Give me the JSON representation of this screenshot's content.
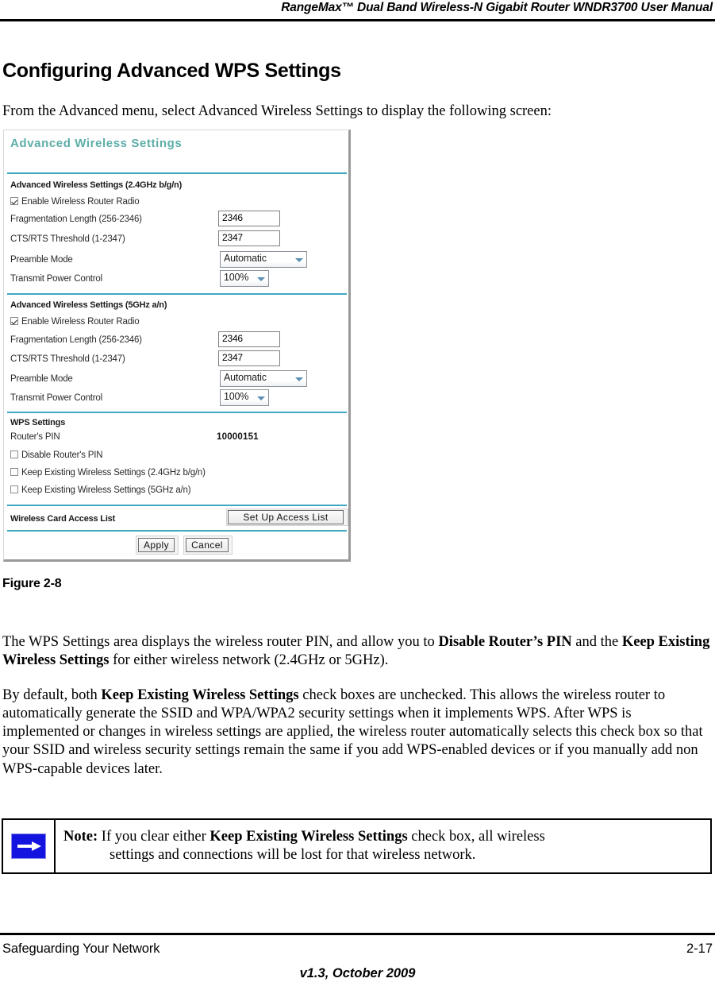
{
  "header": {
    "title": "RangeMax™ Dual Band Wireless-N Gigabit Router WNDR3700 User Manual"
  },
  "page": {
    "heading": "Configuring Advanced WPS Settings",
    "intro": "From the Advanced menu, select Advanced Wireless Settings to display the following screen:",
    "figure_caption": "Figure 2-8"
  },
  "figure": {
    "window_title": "Advanced Wireless Settings",
    "title_color": "#5cada7",
    "divider_color": "#3fa9c4",
    "sections": [
      {
        "title": "Advanced Wireless Settings (2.4GHz b/g/n)",
        "enable_radio_label": "Enable Wireless Router Radio",
        "enable_radio_checked": true,
        "fields": [
          {
            "label": "Fragmentation Length (256-2346)",
            "value": "2346",
            "type": "text"
          },
          {
            "label": "CTS/RTS Threshold (1-2347)",
            "value": "2347",
            "type": "text"
          },
          {
            "label": "Preamble Mode",
            "value": "Automatic",
            "type": "select"
          },
          {
            "label": "Transmit Power Control",
            "value": "100%",
            "type": "select"
          }
        ]
      },
      {
        "title": "Advanced Wireless Settings (5GHz a/n)",
        "enable_radio_label": "Enable Wireless Router Radio",
        "enable_radio_checked": true,
        "fields": [
          {
            "label": "Fragmentation Length (256-2346)",
            "value": "2346",
            "type": "text"
          },
          {
            "label": "CTS/RTS Threshold (1-2347)",
            "value": "2347",
            "type": "text"
          },
          {
            "label": "Preamble Mode",
            "value": "Automatic",
            "type": "select"
          },
          {
            "label": "Transmit Power Control",
            "value": "100%",
            "type": "select"
          }
        ]
      }
    ],
    "wps": {
      "title": "WPS Settings",
      "pin_label": "Router's PIN",
      "pin_value": "10000151",
      "checkboxes": [
        {
          "label": "Disable Router's PIN",
          "checked": false
        },
        {
          "label": "Keep Existing Wireless Settings (2.4GHz b/g/n)",
          "checked": false
        },
        {
          "label": "Keep Existing Wireless Settings (5GHz a/n)",
          "checked": false
        }
      ]
    },
    "access_list": {
      "label": "Wireless Card Access List",
      "button": "Set Up Access List"
    },
    "actions": {
      "apply": "Apply",
      "cancel": "Cancel"
    }
  },
  "body": {
    "para1_a": "The WPS Settings area displays the wireless router PIN, and allow you to ",
    "para1_b": "Disable Router’s PIN",
    "para1_c": " and the ",
    "para1_d": "Keep Existing Wireless Settings",
    "para1_e": " for either wireless network (2.4GHz or 5GHz).",
    "para2_a": "By default, both ",
    "para2_b": "Keep Existing Wireless Settings",
    "para2_c": " check boxes are unchecked. This allows the wireless router to automatically generate the SSID and WPA/WPA2 security settings when it implements WPS. After WPS is implemented or changes in wireless settings are applied, the wireless router automatically selects this check box so that your SSID and wireless security settings remain the same if you add WPS-enabled devices or if you manually add non WPS-capable devices later."
  },
  "note": {
    "icon_color": "#1414e0",
    "label": "Note:",
    "text_a": " If you clear either ",
    "text_b": "Keep Existing Wireless Settings",
    "text_c": " check box, all wireless",
    "text_d": "settings and connections will be lost for that wireless network."
  },
  "footer": {
    "left": "Safeguarding Your Network",
    "page_number": "2-17",
    "version": "v1.3, October 2009"
  }
}
